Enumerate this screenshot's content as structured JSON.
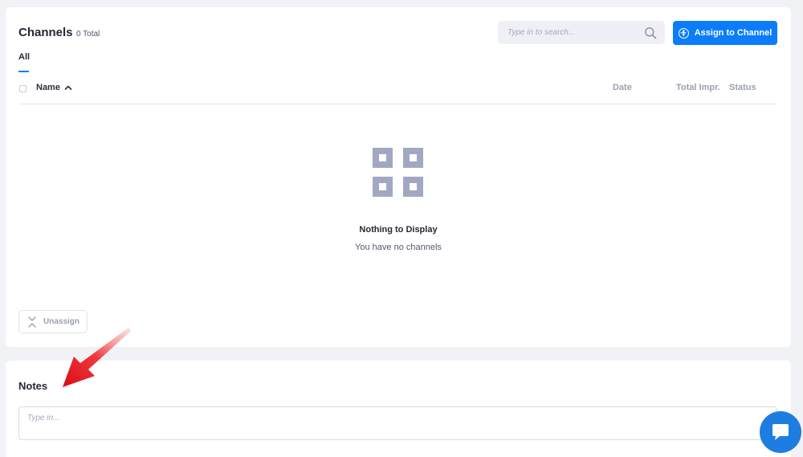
{
  "channels": {
    "title": "Channels",
    "total": "0 Total",
    "search_placeholder": "Type in to search...",
    "assign_button": "Assign to Channel",
    "tabs": [
      {
        "label": "All",
        "active": true
      }
    ],
    "columns": {
      "name": "Name",
      "date": "Date",
      "total_impr": "Total Impr.",
      "status": "Status"
    },
    "empty_title": "Nothing to Display",
    "empty_subtitle": "You have no channels",
    "unassign_button": "Unassign"
  },
  "notes": {
    "title": "Notes",
    "placeholder": "Type in..."
  },
  "icons": {
    "search": "search-icon",
    "assign": "plus-circle-icon",
    "sort": "chevron-up-icon",
    "empty": "grid-squares-icon",
    "unassign": "unassign-icon",
    "chat": "chat-bubble-icon",
    "annotation": "red-arrow-icon"
  },
  "colors": {
    "accent": "#0b7dfb",
    "chat": "#1e7de0",
    "empty_icon": "#a2a8c2",
    "arrow": "#e8141d"
  }
}
